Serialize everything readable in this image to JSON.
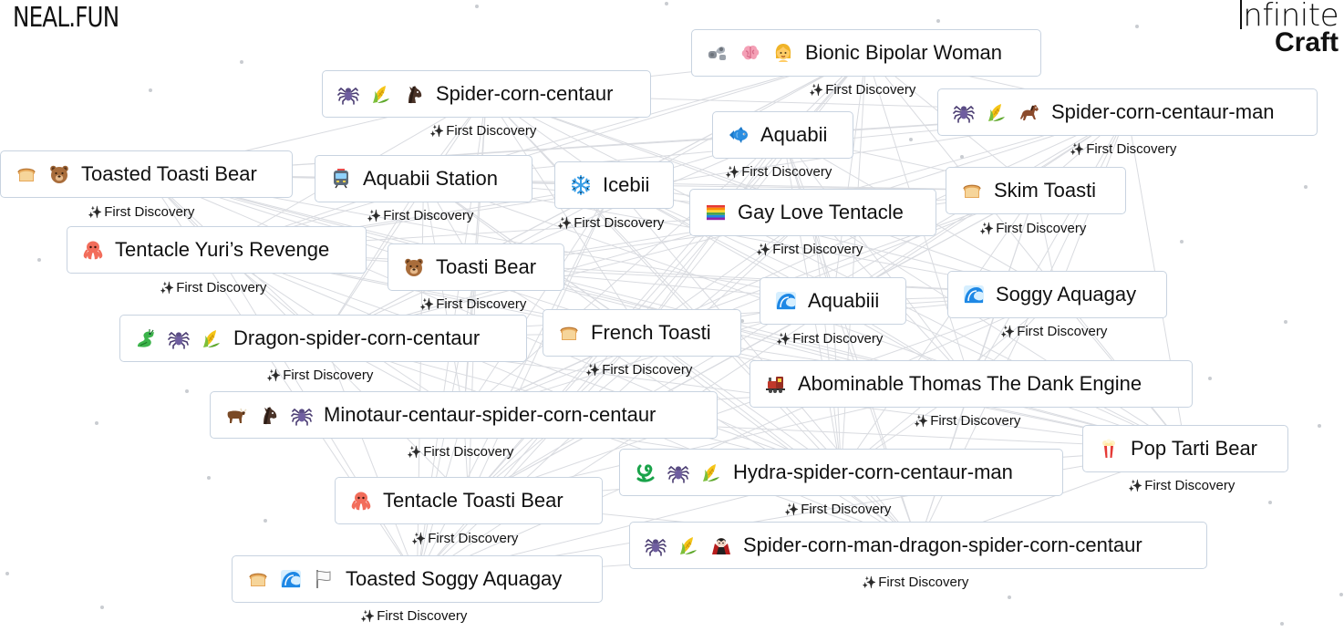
{
  "logo": "NEAL.FUN",
  "brand": {
    "line1": "nfinite",
    "line2": "Craft"
  },
  "discovery_label": "First Discovery",
  "items": [
    {
      "label": "Bionic Bipolar Woman",
      "emojis": [
        "mechanical-arm",
        "brain",
        "woman"
      ]
    },
    {
      "label": "Spider-corn-centaur",
      "emojis": [
        "spider",
        "corn",
        "horse-head"
      ]
    },
    {
      "label": "Spider-corn-centaur-man",
      "emojis": [
        "spider",
        "corn",
        "horse"
      ]
    },
    {
      "label": "Aquabii",
      "emojis": [
        "fish"
      ]
    },
    {
      "label": "Toasted Toasti Bear",
      "emojis": [
        "bread",
        "bear"
      ]
    },
    {
      "label": "Aquabii Station",
      "emojis": [
        "tram"
      ]
    },
    {
      "label": "Icebii",
      "emojis": [
        "snowflake"
      ]
    },
    {
      "label": "Skim Toasti",
      "emojis": [
        "bread"
      ]
    },
    {
      "label": "Gay Love Tentacle",
      "emojis": [
        "rainbow-flag"
      ]
    },
    {
      "label": "Tentacle Yuri’s Revenge",
      "emojis": [
        "octopus"
      ]
    },
    {
      "label": "Toasti Bear",
      "emojis": [
        "bear"
      ]
    },
    {
      "label": "Aquabiii",
      "emojis": [
        "wave"
      ]
    },
    {
      "label": "Soggy Aquagay",
      "emojis": [
        "wave"
      ]
    },
    {
      "label": "Dragon-spider-corn-centaur",
      "emojis": [
        "dragon",
        "spider",
        "corn"
      ]
    },
    {
      "label": "French Toasti",
      "emojis": [
        "bread"
      ]
    },
    {
      "label": "Abominable Thomas The Dank Engine",
      "emojis": [
        "locomotive"
      ]
    },
    {
      "label": "Minotaur-centaur-spider-corn-centaur",
      "emojis": [
        "ox",
        "horse-head",
        "spider"
      ]
    },
    {
      "label": "Pop Tarti Bear",
      "emojis": [
        "popcorn"
      ]
    },
    {
      "label": "Hydra-spider-corn-centaur-man",
      "emojis": [
        "hydra",
        "spider",
        "corn"
      ]
    },
    {
      "label": "Tentacle Toasti Bear",
      "emojis": [
        "octopus"
      ]
    },
    {
      "label": "Spider-corn-man-dragon-spider-corn-centaur",
      "emojis": [
        "spider",
        "corn",
        "vampire"
      ]
    },
    {
      "label": "Toasted Soggy Aquagay",
      "emojis": [
        "bread",
        "wave",
        "white-flag"
      ]
    }
  ]
}
